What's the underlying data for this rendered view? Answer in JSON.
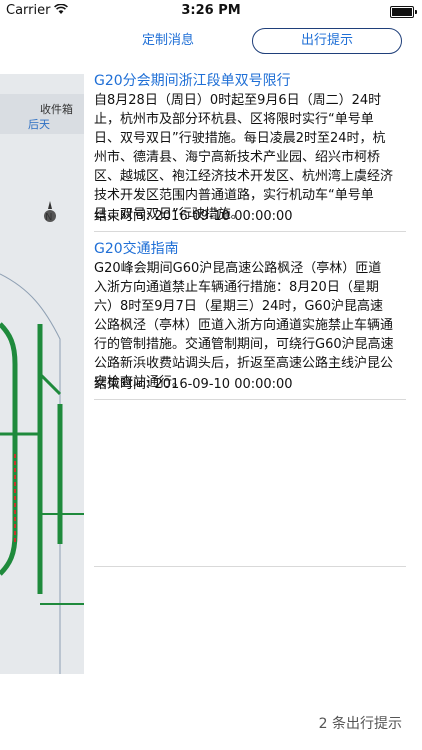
{
  "status_bar": {
    "carrier": "Carrier",
    "time": "3:26 PM"
  },
  "tabs": {
    "custom": "定制消息",
    "travel": "出行提示",
    "active": "travel"
  },
  "map": {
    "inbox_label": "收件箱",
    "days_label": "后天",
    "compass_label": "N"
  },
  "notices": [
    {
      "title": "G20分会期间浙江段单双号限行",
      "body": "自8月28日（周日）0时起至9月6日（周二）24时止，杭州市及部分环杭县、区将限时实行“单号单日、双号双日”行驶措施。每日凌晨2时至24时，杭州市、德清县、海宁高新技术产业园、绍兴市柯桥区、越城区、袍江经济技术开发区、杭州湾上虞经济技术开发区范围内普通道路，实行机动车“单号单日、双号双日”行驶措施。",
      "end_time": "结束时间: 2016-09-10 00:00:00"
    },
    {
      "title": "G20交通指南",
      "body": "G20峰会期间G60沪昆高速公路枫泾（亭林）匝道入浙方向通道禁止车辆通行措施：8月20日（星期六）8时至9月7日（星期三）24时，G60沪昆高速公路枫泾（亭林）匝道入浙方向通道实施禁止车辆通行的管制措施。交通管制期间，可绕行G60沪昆高速公路新浜收费站调头后，折返至高速公路主线沪昆公安检查站通行。",
      "end_time": "结束时间: 2016-09-10 00:00:00"
    }
  ],
  "footer": {
    "count_text": "2 条出行提示"
  },
  "colors": {
    "accent": "#1f6fd6",
    "segment_border": "#1f3f7a",
    "map_line": "#1f8a3c"
  }
}
